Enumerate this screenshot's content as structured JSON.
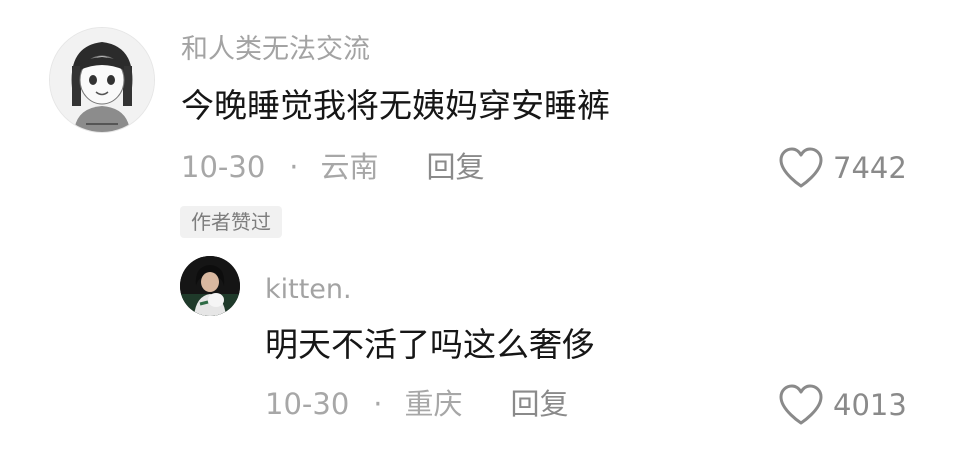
{
  "comment": {
    "username": "和人类无法交流",
    "text": "今晚睡觉我将无姨妈穿安睡裤",
    "date": "10-30",
    "separator": "·",
    "location": "云南",
    "reply_label": "回复",
    "like_icon": "heart-outline-icon",
    "like_count": "7442",
    "author_badge": "作者赞过"
  },
  "reply": {
    "username": "kitten.",
    "text": "明天不活了吗这么奢侈",
    "date": "10-30",
    "separator": "·",
    "location": "重庆",
    "reply_label": "回复",
    "like_icon": "heart-outline-icon",
    "like_count": "4013"
  },
  "colors": {
    "username": "#a3a3a3",
    "text": "#161616",
    "meta": "#a7a7a7",
    "badge_bg": "#f1f1f1"
  }
}
